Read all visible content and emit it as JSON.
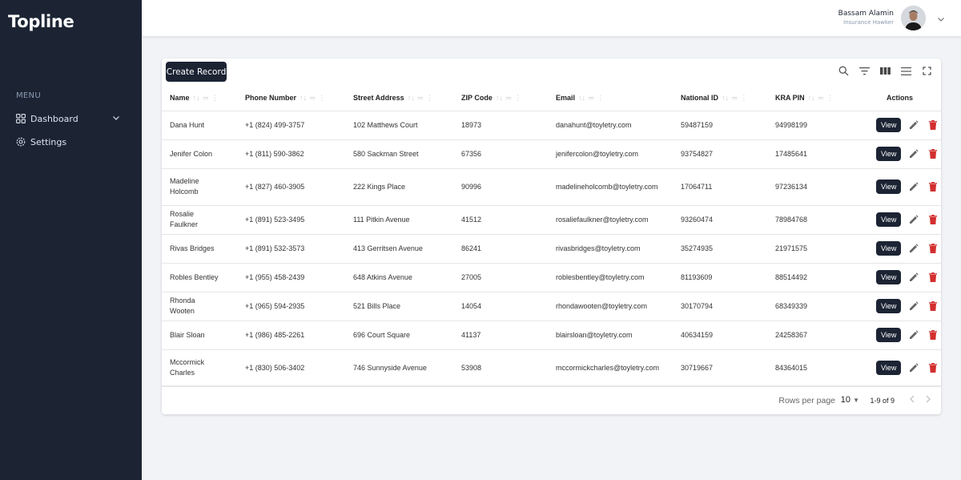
{
  "app": {
    "title": "Topline"
  },
  "sidebar": {
    "menu_label": "MENU",
    "items": [
      {
        "label": "Dashboard",
        "icon": "grid-icon",
        "expandable": true
      },
      {
        "label": "Settings",
        "icon": "gear-icon",
        "expandable": false
      }
    ]
  },
  "header": {
    "user_name": "Bassam Alamin",
    "user_role": "Insurance Hawker"
  },
  "toolbar": {
    "create_label": "Create Record",
    "icons": [
      "search-icon",
      "filter-icon",
      "columns-icon",
      "density-icon",
      "fullscreen-icon"
    ]
  },
  "table": {
    "columns": [
      "Name",
      "Phone Number",
      "Street Address",
      "ZIP Code",
      "Email",
      "National ID",
      "KRA PIN",
      "Actions"
    ],
    "view_label": "View",
    "rows": [
      {
        "name": "Dana Hunt",
        "phone": "+1 (824) 499-3757",
        "address": "102 Matthews Court",
        "zip": "18973",
        "email": "danahunt@toyletry.com",
        "national_id": "59487159",
        "kra_pin": "94998199"
      },
      {
        "name": "Jenifer Colon",
        "phone": "+1 (811) 590-3862",
        "address": "580 Sackman Street",
        "zip": "67356",
        "email": "jenifercolon@toyletry.com",
        "national_id": "93754827",
        "kra_pin": "17485641"
      },
      {
        "name": "Madeline Holcomb",
        "phone": "+1 (827) 460-3905",
        "address": "222 Kings Place",
        "zip": "90996",
        "email": "madelineholcomb@toyletry.com",
        "national_id": "17064711",
        "kra_pin": "97236134"
      },
      {
        "name": "Rosalie Faulkner",
        "phone": "+1 (891) 523-3495",
        "address": "111 Pitkin Avenue",
        "zip": "41512",
        "email": "rosaliefaulkner@toyletry.com",
        "national_id": "93260474",
        "kra_pin": "78984768"
      },
      {
        "name": "Rivas Bridges",
        "phone": "+1 (891) 532-3573",
        "address": "413 Gerritsen Avenue",
        "zip": "86241",
        "email": "rivasbridges@toyletry.com",
        "national_id": "35274935",
        "kra_pin": "21971575"
      },
      {
        "name": "Robles Bentley",
        "phone": "+1 (955) 458-2439",
        "address": "648 Atkins Avenue",
        "zip": "27005",
        "email": "roblesbentley@toyletry.com",
        "national_id": "81193609",
        "kra_pin": "88514492"
      },
      {
        "name": "Rhonda Wooten",
        "phone": "+1 (965) 594-2935",
        "address": "521 Bills Place",
        "zip": "14054",
        "email": "rhondawooten@toyletry.com",
        "national_id": "30170794",
        "kra_pin": "68349339"
      },
      {
        "name": "Blair Sloan",
        "phone": "+1 (986) 485-2261",
        "address": "696 Court Square",
        "zip": "41137",
        "email": "blairsloan@toyletry.com",
        "national_id": "40634159",
        "kra_pin": "24258367"
      },
      {
        "name": "Mccormick Charles",
        "phone": "+1 (830) 506-3402",
        "address": "746 Sunnyside Avenue",
        "zip": "53908",
        "email": "mccormickcharles@toyletry.com",
        "national_id": "30719667",
        "kra_pin": "84364015"
      }
    ]
  },
  "pagination": {
    "rows_per_page_label": "Rows per page",
    "rows_per_page": "10",
    "range": "1-9 of 9"
  },
  "colors": {
    "sidebar": "#1c2434",
    "delete": "#d32f2f",
    "edit": "#666666"
  }
}
